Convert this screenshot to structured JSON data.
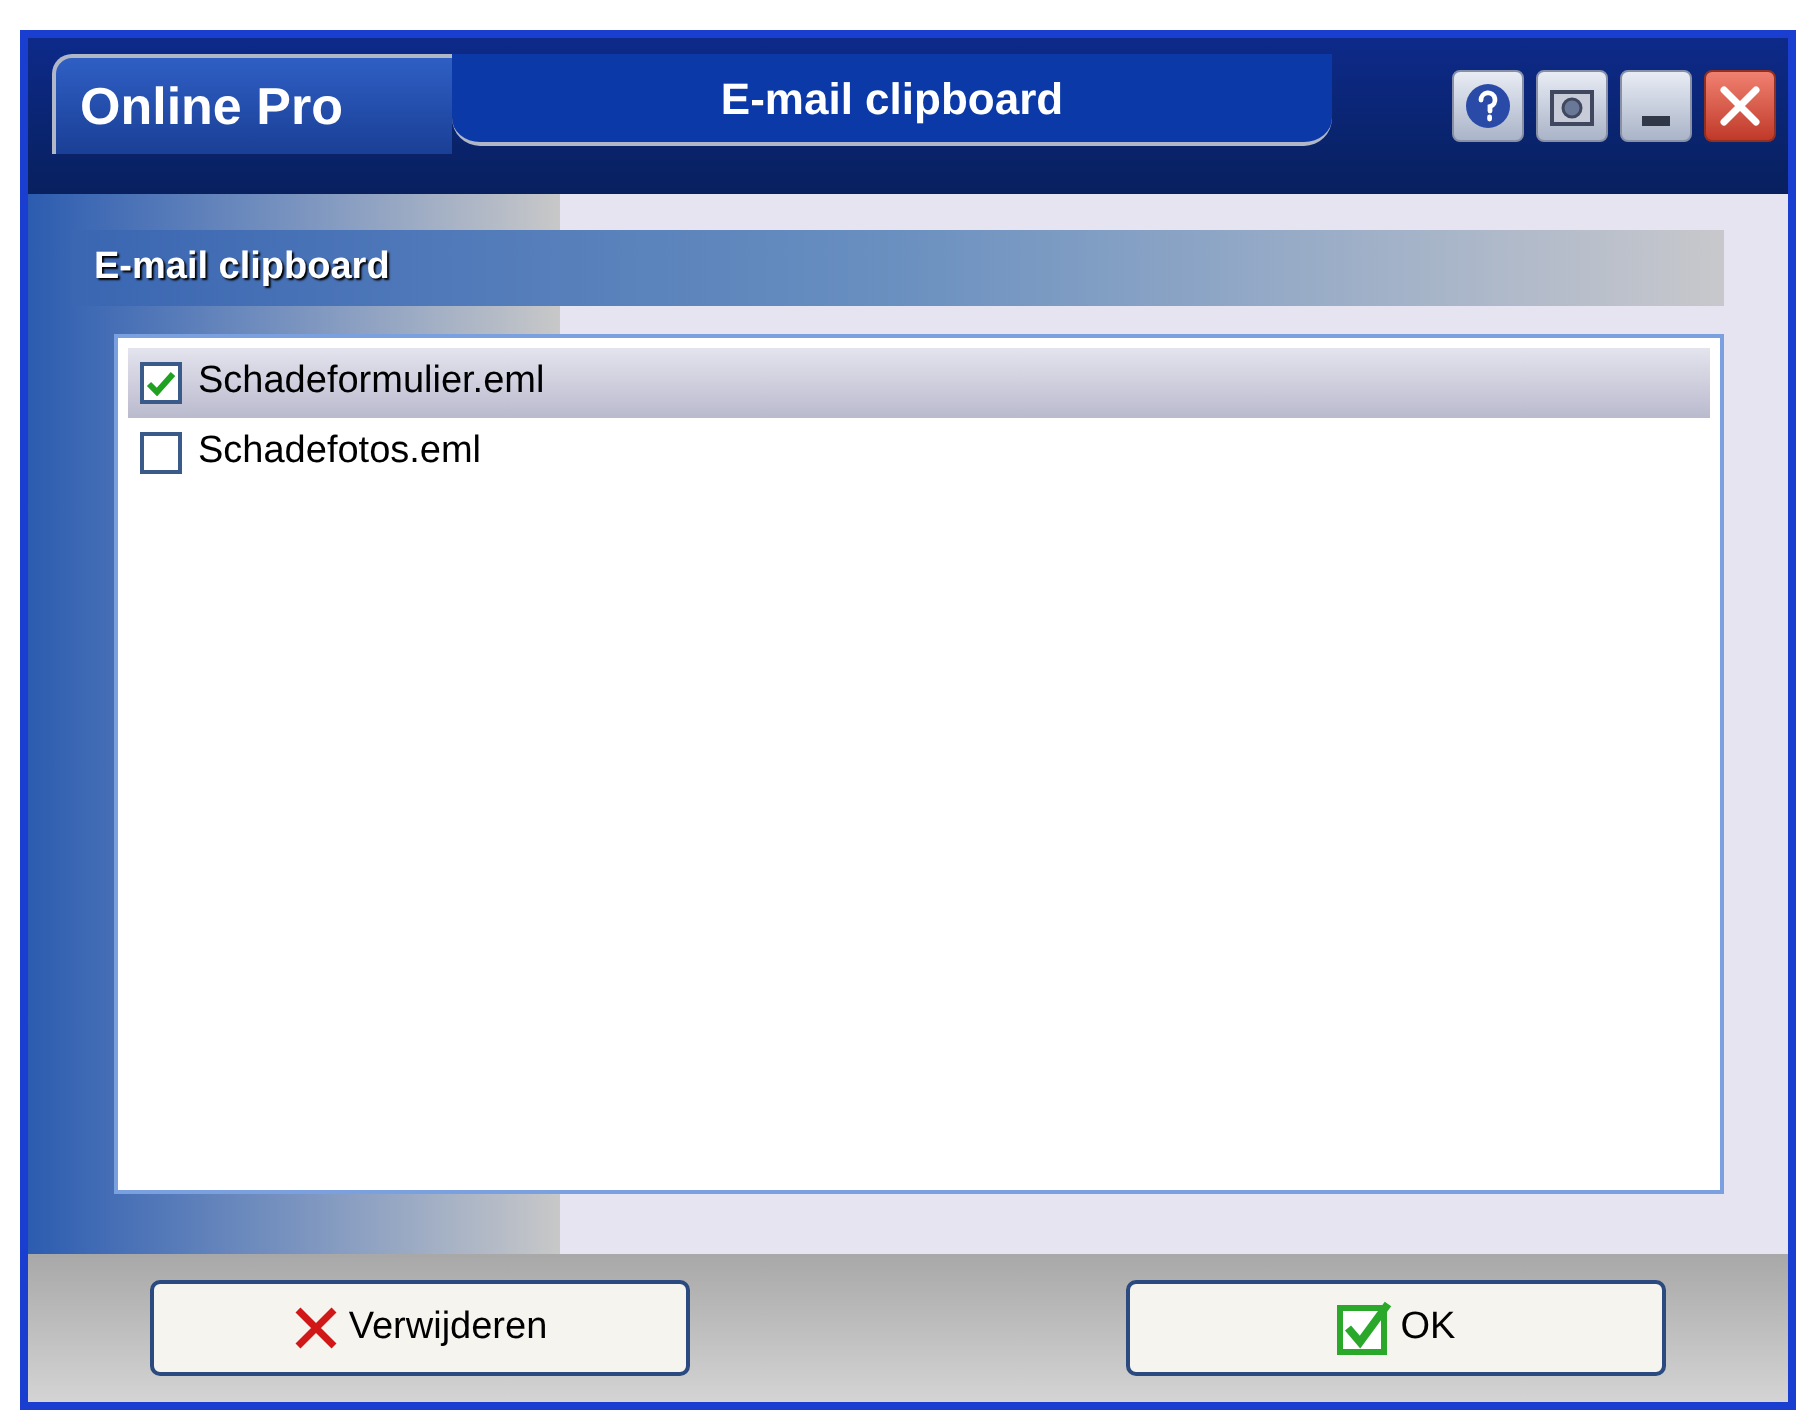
{
  "window": {
    "app_name": "Online Pro",
    "title": "E-mail clipboard"
  },
  "panel": {
    "heading": "E-mail clipboard"
  },
  "files": [
    {
      "name": "Schadeformulier.eml",
      "checked": true,
      "selected": true
    },
    {
      "name": "Schadefotos.eml",
      "checked": false,
      "selected": false
    }
  ],
  "buttons": [
    {
      "kind": "delete",
      "label": "Verwijderen"
    },
    {
      "kind": "confirm",
      "label": "OK"
    }
  ]
}
